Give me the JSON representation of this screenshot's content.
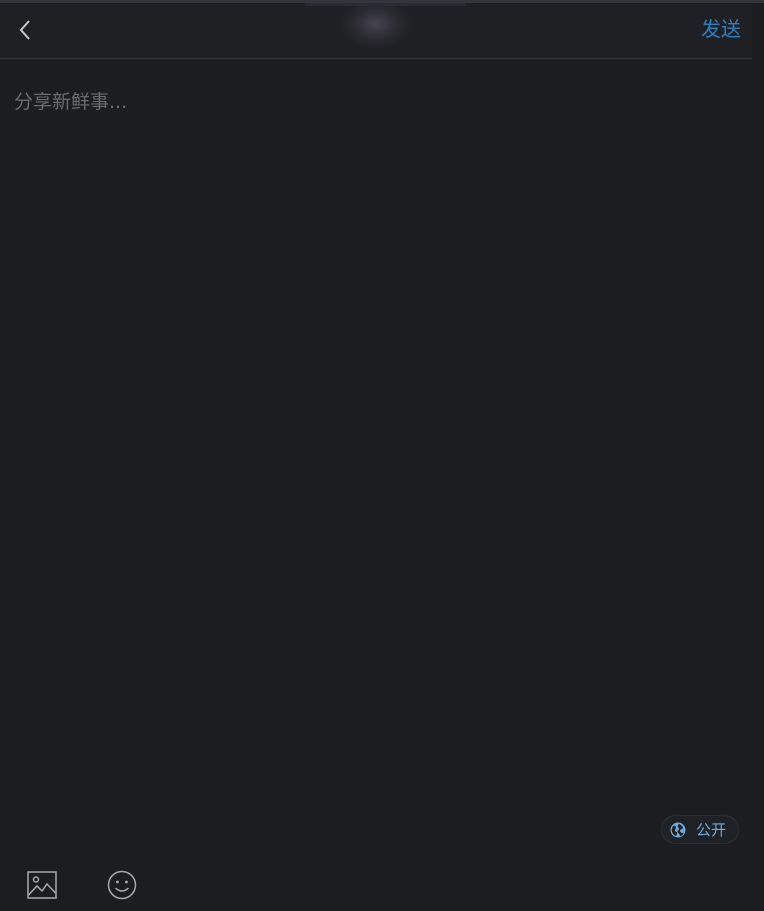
{
  "header": {
    "back_icon": "chevron-left-icon",
    "send_label": "发送"
  },
  "composer": {
    "placeholder": "分享新鲜事...",
    "value": ""
  },
  "visibility": {
    "icon": "globe-icon",
    "label": "公开"
  },
  "toolbar": {
    "image_icon": "image-icon",
    "emoji_icon": "smiley-icon"
  },
  "colors": {
    "background": "#1c1d20",
    "accent": "#2f7fc0",
    "chip_text": "#6fa9d8",
    "placeholder": "#6a6b70"
  }
}
